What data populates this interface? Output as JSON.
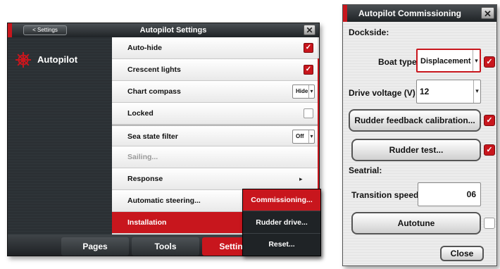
{
  "settings_window": {
    "back_label": "< Settings",
    "title": "Autopilot Settings",
    "close_glyph": "✕",
    "sidebar": {
      "item_label": "Autopilot",
      "item_icon": "helm-icon"
    },
    "rows": [
      {
        "label": "Auto-hide",
        "control": "checkbox",
        "checked": true
      },
      {
        "label": "Crescent lights",
        "control": "checkbox",
        "checked": true
      },
      {
        "label": "Chart compass",
        "control": "dropdown",
        "value": "Hide"
      },
      {
        "label": "Locked",
        "control": "checkbox",
        "checked": false
      },
      {
        "label": "Sea state filter",
        "control": "dropdown",
        "value": "Off"
      },
      {
        "label": "Sailing...",
        "control": "none",
        "disabled": true
      },
      {
        "label": "Response",
        "control": "chevron"
      },
      {
        "label": "Automatic steering...",
        "control": "none"
      },
      {
        "label": "Installation",
        "control": "none",
        "selected": true
      }
    ],
    "bottom_tabs": [
      "Pages",
      "Tools",
      "Settings"
    ],
    "active_tab": "Settings"
  },
  "installation_menu": {
    "items": [
      "Commissioning...",
      "Rudder drive...",
      "Reset..."
    ],
    "active_item": "Commissioning..."
  },
  "commissioning_window": {
    "title": "Autopilot Commissioning",
    "close_glyph": "✕",
    "dockside_heading": "Dockside:",
    "boat_type_label": "Boat type",
    "boat_type_value": "Displacement",
    "drive_voltage_label": "Drive voltage (V)",
    "drive_voltage_value": "12",
    "rudder_feedback_button": "Rudder feedback calibration...",
    "rudder_test_button": "Rudder test...",
    "seatrial_heading": "Seatrial:",
    "transition_speed_label": "Transition speed",
    "transition_speed_value": "06",
    "autotune_button": "Autotune",
    "close_button": "Close"
  },
  "colors": {
    "accent": "#c8161d",
    "dark_panel": "#2a2f33"
  }
}
